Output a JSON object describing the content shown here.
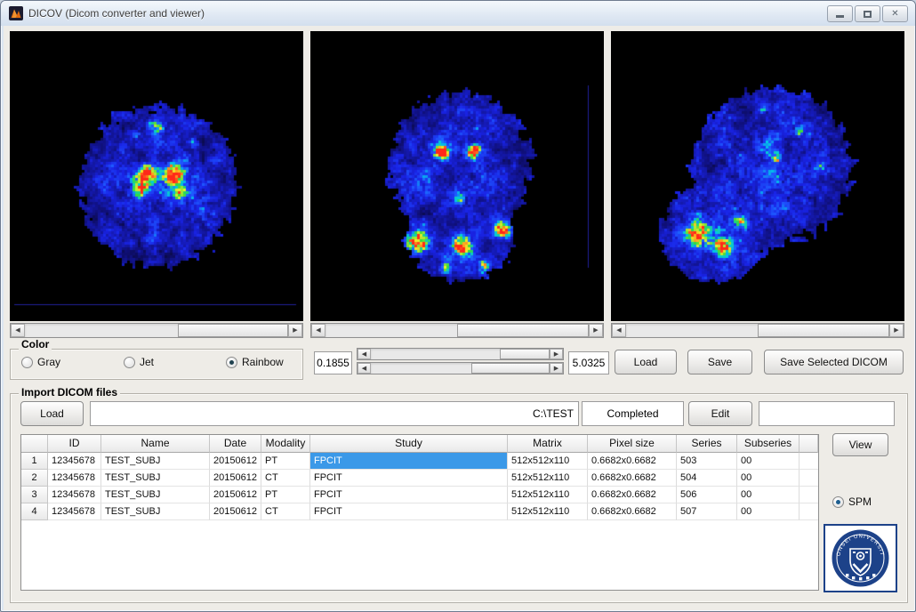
{
  "window": {
    "title": "DICOV (Dicom converter and viewer)"
  },
  "icons": {
    "arrow_left": "◀",
    "arrow_right": "▶",
    "close": "✕"
  },
  "viewers": {
    "panels": [
      {
        "name": "axial-view"
      },
      {
        "name": "coronal-view"
      },
      {
        "name": "sagittal-view"
      }
    ]
  },
  "color_panel": {
    "label": "Color",
    "options": [
      {
        "label": "Gray",
        "selected": false
      },
      {
        "label": "Jet",
        "selected": false
      },
      {
        "label": "Rainbow",
        "selected": true
      }
    ]
  },
  "range": {
    "min": "0.1855",
    "max": "5.0325"
  },
  "actions": {
    "load": "Load",
    "save": "Save",
    "save_selected": "Save Selected DICOM"
  },
  "import": {
    "label": "Import DICOM files",
    "load": "Load",
    "path": "C:\\TEST",
    "status": "Completed",
    "edit": "Edit",
    "extra": ""
  },
  "table": {
    "columns": [
      "ID",
      "Name",
      "Date",
      "Modality",
      "Study",
      "Matrix",
      "Pixel size",
      "Series",
      "Subseries"
    ],
    "rows": [
      {
        "num": "1",
        "id": "12345678",
        "name": "TEST_SUBJ",
        "date": "20150612",
        "modality": "PT",
        "study": "FPCIT",
        "matrix": "512x512x110",
        "pixel_size": "0.6682x0.6682",
        "series": "503",
        "subseries": "00",
        "study_selected": true
      },
      {
        "num": "2",
        "id": "12345678",
        "name": "TEST_SUBJ",
        "date": "20150612",
        "modality": "CT",
        "study": "FPCIT",
        "matrix": "512x512x110",
        "pixel_size": "0.6682x0.6682",
        "series": "504",
        "subseries": "00",
        "study_selected": false
      },
      {
        "num": "3",
        "id": "12345678",
        "name": "TEST_SUBJ",
        "date": "20150612",
        "modality": "PT",
        "study": "FPCIT",
        "matrix": "512x512x110",
        "pixel_size": "0.6682x0.6682",
        "series": "506",
        "subseries": "00",
        "study_selected": false
      },
      {
        "num": "4",
        "id": "12345678",
        "name": "TEST_SUBJ",
        "date": "20150612",
        "modality": "CT",
        "study": "FPCIT",
        "matrix": "512x512x110",
        "pixel_size": "0.6682x0.6682",
        "series": "507",
        "subseries": "00",
        "study_selected": false
      }
    ]
  },
  "side": {
    "view": "View",
    "spm": "SPM",
    "spm_selected": true
  },
  "logo": {
    "ring_text": "YONSEI UNIVERSITY"
  },
  "colors": {
    "selection": "#3b99e8",
    "logo_blue": "#1d4289"
  }
}
